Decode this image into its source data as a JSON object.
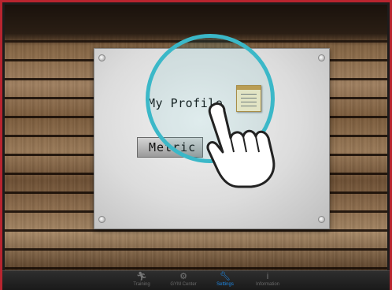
{
  "screen": {
    "board": {
      "title": "My Profile",
      "metric_button_label": "Metric"
    },
    "tutorial_hint": {
      "icon": "pointing-hand-icon"
    },
    "tabbar": {
      "active_color": "#1e88e5",
      "tabs": [
        {
          "label": "Training",
          "icon": "runner-icon",
          "active": false
        },
        {
          "label": "GYM Center",
          "icon": "gym-center-icon",
          "active": false
        },
        {
          "label": "Settings",
          "icon": "wrench-icon",
          "active": true
        },
        {
          "label": "Information",
          "icon": "info-icon",
          "active": false
        }
      ]
    }
  }
}
